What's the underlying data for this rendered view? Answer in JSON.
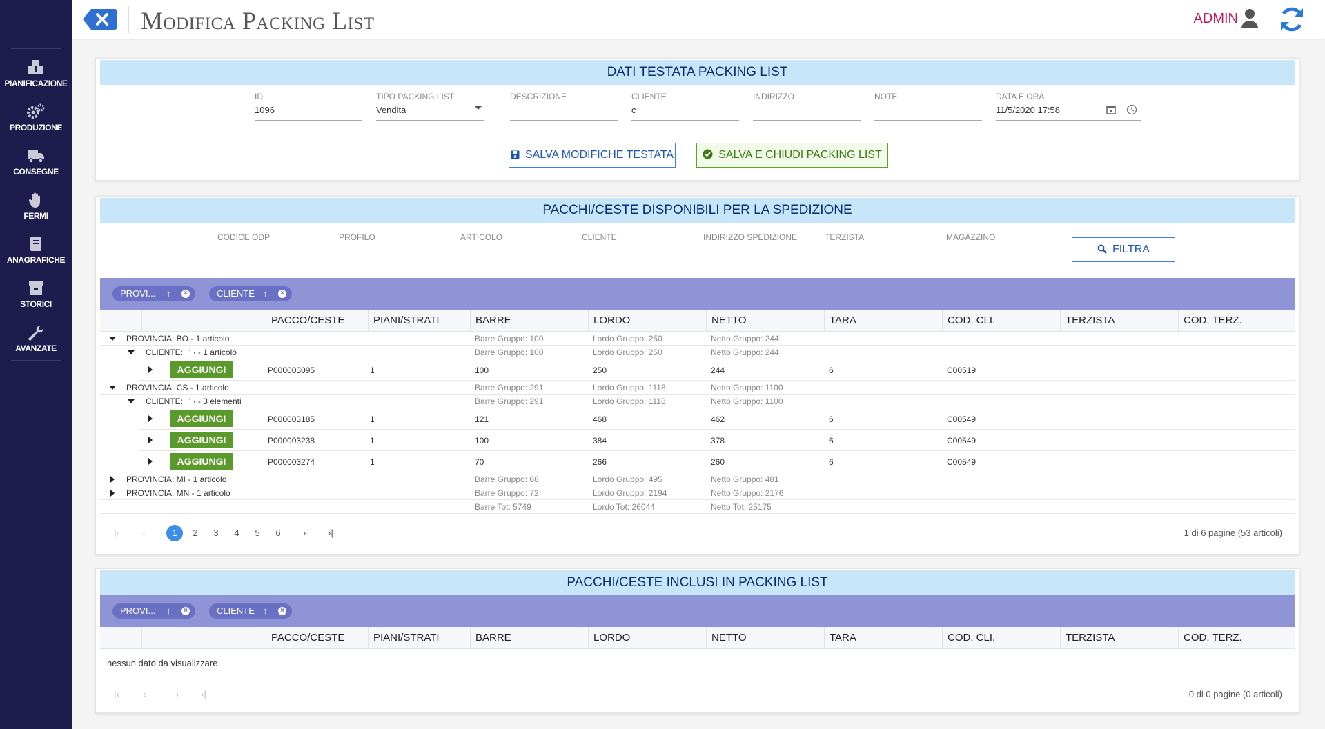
{
  "sidebar": {
    "items": [
      {
        "label": "PIANIFICAZIONE",
        "icon": "boxes-icon"
      },
      {
        "label": "PRODUZIONE",
        "icon": "gears-icon"
      },
      {
        "label": "CONSEGNE",
        "icon": "truck-icon"
      },
      {
        "label": "FERMI",
        "icon": "hand-icon"
      },
      {
        "label": "ANAGRAFICHE",
        "icon": "book-icon"
      },
      {
        "label": "STORICI",
        "icon": "archive-icon"
      },
      {
        "label": "AVANZATE",
        "icon": "wrench-icon"
      }
    ]
  },
  "header": {
    "title": "Modifica Packing List",
    "user": "ADMIN"
  },
  "testata": {
    "title": "DATI TESTATA PACKING LIST",
    "fields": [
      {
        "label": "ID",
        "value": "1096"
      },
      {
        "label": "TIPO PACKING LIST",
        "value": "Vendita"
      },
      {
        "label": "DESCRIZIONE",
        "value": ""
      },
      {
        "label": "CLIENTE",
        "value": "c"
      },
      {
        "label": "INDIRIZZO",
        "value": ""
      },
      {
        "label": "NOTE",
        "value": ""
      },
      {
        "label": "DATA E ORA",
        "value": "11/5/2020 17:58"
      }
    ],
    "save_label": "SALVA MODIFICHE TESTATA",
    "save_close_label": "SALVA E CHIUDI PACKING LIST"
  },
  "disponibili": {
    "title": "PACCHI/CESTE DISPONIBILI PER LA SPEDIZIONE",
    "filters": [
      {
        "label": "CODICE ODP"
      },
      {
        "label": "PROFILO"
      },
      {
        "label": "ARTICOLO"
      },
      {
        "label": "CLIENTE"
      },
      {
        "label": "INDIRIZZO SPEDIZIONE"
      },
      {
        "label": "TERZISTA"
      },
      {
        "label": "MAGAZZINO"
      }
    ],
    "filter_button": "FILTRA",
    "chips": [
      "PROVI...",
      "CLIENTE"
    ],
    "columns": [
      "PACCO/CESTE",
      "PIANI/STRATI",
      "BARRE",
      "LORDO",
      "NETTO",
      "TARA",
      "COD. CLI.",
      "TERZISTA",
      "COD. TERZ."
    ],
    "add_label": "AGGIUNGI",
    "groups": {
      "bo": {
        "label": "PROVINCIA: BO - 1 articolo",
        "barre": "Barre Gruppo: 100",
        "lordo": "Lordo Gruppo: 250",
        "netto": "Netto Gruppo: 244"
      },
      "bo_cli": {
        "label": "CLIENTE: ' ' · - 1 articolo",
        "barre": "Barre Gruppo: 100",
        "lordo": "Lordo Gruppo: 250",
        "netto": "Netto Gruppo: 244"
      },
      "cs": {
        "label": "PROVINCIA: CS - 1 articolo",
        "barre": "Barre Gruppo: 291",
        "lordo": "Lordo Gruppo: 1118",
        "netto": "Netto Gruppo: 1100"
      },
      "cs_cli": {
        "label": "CLIENTE: ' ' · - 3 elementi",
        "barre": "Barre Gruppo: 291",
        "lordo": "Lordo Gruppo: 1118",
        "netto": "Netto Gruppo: 1100"
      },
      "mi": {
        "label": "PROVINCIA: MI - 1 articolo",
        "barre": "Barre Gruppo: 68",
        "lordo": "Lordo Gruppo: 495",
        "netto": "Netto Gruppo: 481"
      },
      "mn": {
        "label": "PROVINCIA: MN - 1 articolo",
        "barre": "Barre Gruppo: 72",
        "lordo": "Lordo Gruppo: 2194",
        "netto": "Netto Gruppo: 2176"
      }
    },
    "rows": [
      {
        "pacco": "P000003095",
        "piani": "1",
        "barre": "100",
        "lordo": "250",
        "netto": "244",
        "tara": "6",
        "codcli": "C00519"
      },
      {
        "pacco": "P000003185",
        "piani": "1",
        "barre": "121",
        "lordo": "468",
        "netto": "462",
        "tara": "6",
        "codcli": "C00549"
      },
      {
        "pacco": "P000003238",
        "piani": "1",
        "barre": "100",
        "lordo": "384",
        "netto": "378",
        "tara": "6",
        "codcli": "C00549"
      },
      {
        "pacco": "P000003274",
        "piani": "1",
        "barre": "70",
        "lordo": "266",
        "netto": "260",
        "tara": "6",
        "codcli": "C00549"
      }
    ],
    "totals": {
      "barre": "Barre Tot: 5749",
      "lordo": "Lordo Tot: 26044",
      "netto": "Netto Tot: 25175"
    },
    "pages": [
      "1",
      "2",
      "3",
      "4",
      "5",
      "6"
    ],
    "current_page": "1",
    "pager_info": "1 di 6 pagine (53 articoli)"
  },
  "inclusi": {
    "title": "PACCHI/CESTE INCLUSI IN PACKING LIST",
    "chips": [
      "PROVI...",
      "CLIENTE"
    ],
    "columns": [
      "PACCO/CESTE",
      "PIANI/STRATI",
      "BARRE",
      "LORDO",
      "NETTO",
      "TARA",
      "COD. CLI.",
      "TERZISTA",
      "COD. TERZ."
    ],
    "empty": "nessun dato da visualizzare",
    "pager_info": "0 di 0 pagine (0 articoli)"
  },
  "colors": {
    "sidebar": "#1e1c4d",
    "title_band": "#c8e6fa",
    "group_bar": "#8e94d6",
    "add_button": "#5a9a2a",
    "user": "#c2185b"
  }
}
